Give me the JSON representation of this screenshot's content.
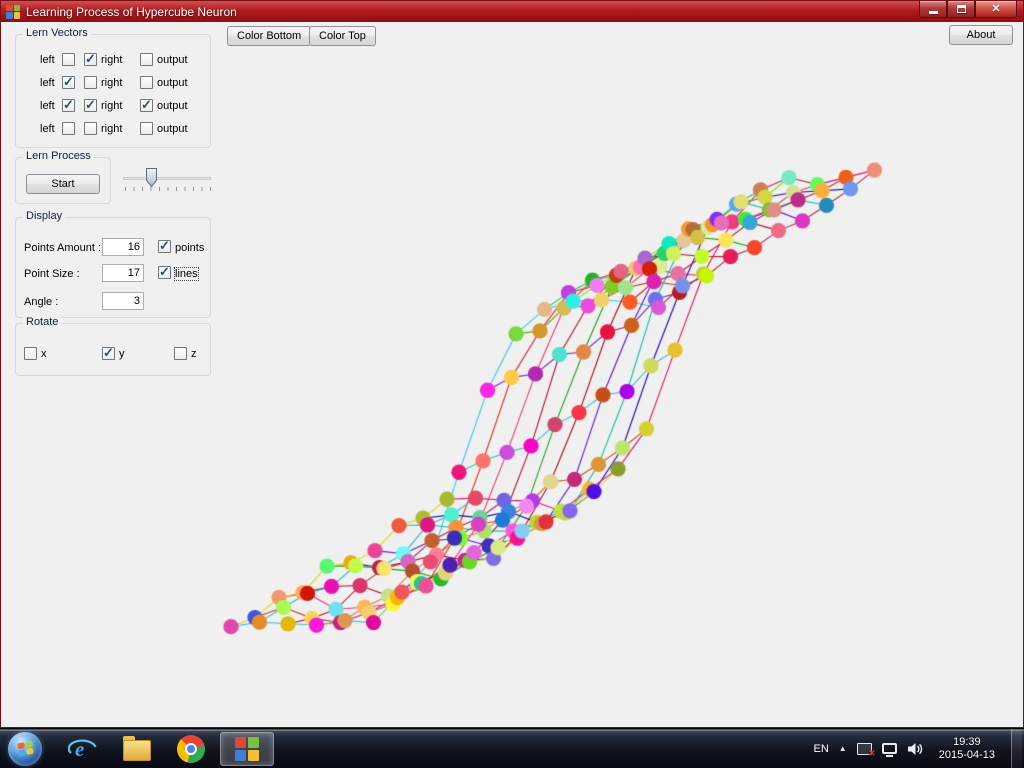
{
  "window": {
    "title": "Learning Process of Hypercube Neuron"
  },
  "icons": {
    "close_glyph": "✕",
    "tray_chevron_glyph": "▲"
  },
  "toolbar": {
    "color_bottom_label": "Color Bottom",
    "color_top_label": "Color Top",
    "about_label": "About"
  },
  "lern_vectors": {
    "title": "Lern Vectors",
    "left_label": "left",
    "right_label": "right",
    "output_label": "output",
    "rows": [
      {
        "left": false,
        "right": true,
        "output": false
      },
      {
        "left": true,
        "right": false,
        "output": false
      },
      {
        "left": true,
        "right": true,
        "output": true
      },
      {
        "left": false,
        "right": false,
        "output": false
      }
    ]
  },
  "lern_process": {
    "title": "Lern Process",
    "start_label": "Start",
    "slider_percent": 30
  },
  "display": {
    "title": "Display",
    "points_amount_label": "Points Amount :",
    "points_amount_value": "16",
    "points_label": "points",
    "points_checked": true,
    "point_size_label": "Point Size :",
    "point_size_value": "17",
    "lines_label": "lines",
    "lines_checked": true,
    "angle_label": "Angle :",
    "angle_value": "3"
  },
  "rotate": {
    "title": "Rotate",
    "x_label": "x",
    "x_checked": false,
    "y_label": "y",
    "y_checked": true,
    "z_label": "z",
    "z_checked": false
  },
  "plot": {
    "cols": 16,
    "rows": 10,
    "origin": [
      30,
      487
    ],
    "step_u": [
      28.5,
      1.1
    ],
    "step_v": [
      24,
      13.6
    ],
    "amplitude": 345,
    "sigmoid_mid": 8.2,
    "sigmoid_slope": 1.0,
    "noise": 0.05,
    "point_size": 17,
    "warm_bias": 0.55,
    "seed": 20150413
  },
  "taskbar": {
    "language": "EN",
    "time": "19:39",
    "date": "2015-04-13"
  }
}
